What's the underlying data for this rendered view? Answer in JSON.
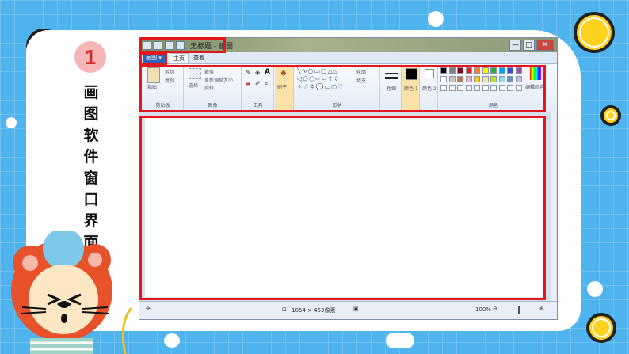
{
  "slide": {
    "number": "1",
    "title_chars": [
      "画",
      "图",
      "软",
      "件",
      "窗",
      "口",
      "界",
      "面"
    ]
  },
  "paint": {
    "window_title": "无标题 - 画图",
    "window_controls": [
      "—",
      "□",
      "✕"
    ],
    "file_tab": "画图 ▾",
    "tabs": [
      "主页",
      "查看"
    ],
    "groups": {
      "clipboard": {
        "label": "剪贴板",
        "paste": "粘贴",
        "cut": "剪切",
        "copy": "复制"
      },
      "image": {
        "label": "图像",
        "select": "选择",
        "crop": "裁剪",
        "resize": "重新调整大小",
        "rotate": "旋转"
      },
      "tools": {
        "label": "工具"
      },
      "brushes": {
        "label": "刷子"
      },
      "shapes": {
        "label": "形状",
        "outline": "轮廓",
        "fill": "填充"
      },
      "size": {
        "label": "粗细"
      },
      "color1": {
        "label": "颜色 1"
      },
      "color2": {
        "label": "颜色 2"
      },
      "colors": {
        "label": "颜色",
        "edit": "编辑颜色"
      }
    },
    "palette": [
      "#000000",
      "#7f7f7f",
      "#880015",
      "#ed1c24",
      "#ff7f27",
      "#fff200",
      "#22b14c",
      "#00a2e8",
      "#3f48cc",
      "#a349a4",
      "#ffffff",
      "#c3c3c3",
      "#b97a57",
      "#ffaec9",
      "#ffc90e",
      "#efe4b0",
      "#b5e61d",
      "#99d9ea",
      "#7092be",
      "#c8bfe7"
    ],
    "status": {
      "dimensions": "1054 × 453像素",
      "zoom": "100%"
    }
  },
  "colors": {
    "highlight_red": "#e3181f",
    "background_blue": "#4fb3ee",
    "sun_yellow": "#ffd21f"
  }
}
